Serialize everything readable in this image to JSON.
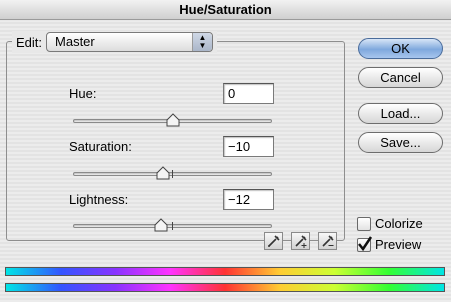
{
  "window": {
    "title": "Hue/Saturation"
  },
  "edit": {
    "label": "Edit:",
    "selected": "Master"
  },
  "hue": {
    "label": "Hue:",
    "value": "0",
    "slider_level": 0.5
  },
  "saturation": {
    "label": "Saturation:",
    "value": "−10",
    "slider_level": 0.45
  },
  "lightness": {
    "label": "Lightness:",
    "value": "−12",
    "slider_level": 0.44
  },
  "buttons": {
    "ok": "OK",
    "cancel": "Cancel",
    "load": "Load...",
    "save": "Save..."
  },
  "colorize": {
    "label": "Colorize",
    "checked": false
  },
  "preview": {
    "label": "Preview",
    "checked": true
  },
  "colors": {
    "default_button": "#7fa8dd",
    "spectrum": [
      "#00e5e5",
      "#3355ff",
      "#8833ff",
      "#ff33ff",
      "#ff3333",
      "#ffcc33",
      "#ccff33",
      "#33ff33",
      "#00e5e5"
    ]
  }
}
